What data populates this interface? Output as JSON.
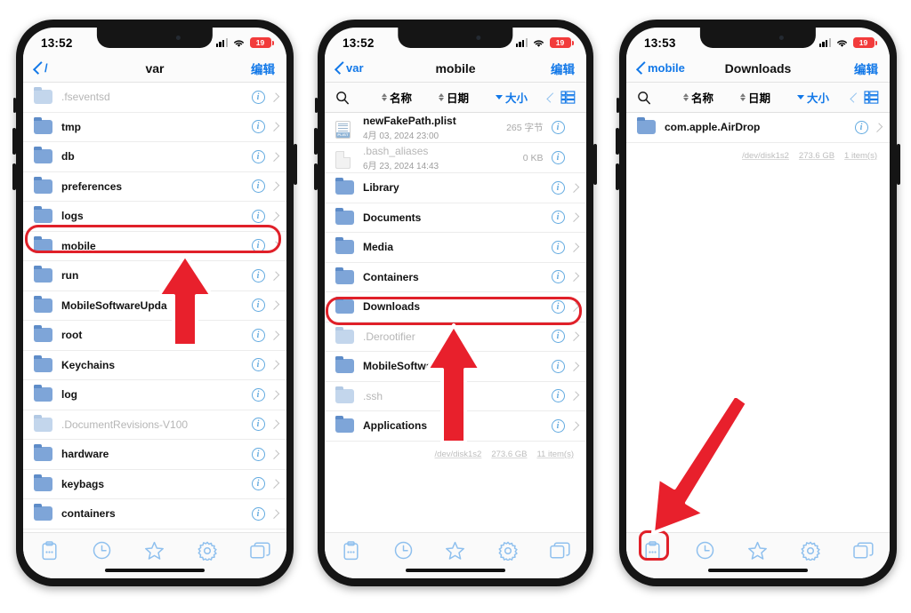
{
  "screenshot": {
    "description": "Three iPhone screenshots of a file manager app showing navigation from /var to mobile to Downloads"
  },
  "phones": [
    {
      "id": "phone-1",
      "status_bar": {
        "time": "13:52",
        "battery": "19",
        "signal_icon": "signal-bars-icon",
        "wifi_icon": "wifi-icon",
        "battery_icon": "battery-low-icon"
      },
      "nav": {
        "back_label": "/",
        "title": "var",
        "edit_label": "编辑"
      },
      "has_sortbar": false,
      "rows": [
        {
          "name": ".fseventsd",
          "kind": "folder",
          "dim": true,
          "clipped": true
        },
        {
          "name": "tmp",
          "kind": "folder",
          "dim": false
        },
        {
          "name": "db",
          "kind": "folder",
          "dim": false
        },
        {
          "name": "preferences",
          "kind": "folder",
          "dim": false
        },
        {
          "name": "logs",
          "kind": "folder",
          "dim": false
        },
        {
          "name": "mobile",
          "kind": "folder",
          "dim": false,
          "highlighted": true
        },
        {
          "name": "run",
          "kind": "folder",
          "dim": false
        },
        {
          "name": "MobileSoftwareUpda",
          "kind": "folder",
          "dim": false
        },
        {
          "name": "root",
          "kind": "folder",
          "dim": false
        },
        {
          "name": "Keychains",
          "kind": "folder",
          "dim": false
        },
        {
          "name": "log",
          "kind": "folder",
          "dim": false
        },
        {
          "name": ".DocumentRevisions-V100",
          "kind": "folder",
          "dim": true
        },
        {
          "name": "hardware",
          "kind": "folder",
          "dim": false
        },
        {
          "name": "keybags",
          "kind": "folder",
          "dim": false
        },
        {
          "name": "containers",
          "kind": "folder",
          "dim": false
        }
      ],
      "meta": null,
      "annotation": {
        "arrow": "up-arrow",
        "highlight": "mobile"
      }
    },
    {
      "id": "phone-2",
      "status_bar": {
        "time": "13:52",
        "battery": "19",
        "signal_icon": "signal-bars-icon",
        "wifi_icon": "wifi-icon",
        "battery_icon": "battery-low-icon"
      },
      "nav": {
        "back_label": "var",
        "title": "mobile",
        "edit_label": "编辑"
      },
      "has_sortbar": true,
      "sortbar": {
        "search_icon": "search-icon",
        "name_label": "名称",
        "date_label": "日期",
        "size_label": "大小",
        "active": "大小",
        "view_icon": "list-view-icon",
        "collapse_icon": "chevron-left-icon"
      },
      "rows": [
        {
          "name": "newFakePath.plist",
          "kind": "plist",
          "sub": "4月 03, 2024 23:00",
          "size": "265 字节",
          "no_chevron": true
        },
        {
          "name": ".bash_aliases",
          "kind": "doc",
          "dim": true,
          "sub": "6月 23, 2024 14:43",
          "size": "0 KB",
          "no_chevron": true
        },
        {
          "name": "Library",
          "kind": "folder",
          "dim": false
        },
        {
          "name": "Documents",
          "kind": "folder",
          "dim": false
        },
        {
          "name": "Media",
          "kind": "folder",
          "dim": false
        },
        {
          "name": "Containers",
          "kind": "folder",
          "dim": false
        },
        {
          "name": "Downloads",
          "kind": "folder",
          "dim": false,
          "highlighted": true
        },
        {
          "name": ".Derootifier",
          "kind": "folder",
          "dim": true
        },
        {
          "name": "MobileSoftwareUpdate",
          "kind": "folder",
          "dim": false
        },
        {
          "name": ".ssh",
          "kind": "folder",
          "dim": true
        },
        {
          "name": "Applications",
          "kind": "folder",
          "dim": false
        }
      ],
      "meta": {
        "device": "/dev/disk1s2",
        "capacity": "273.6 GB",
        "count": "11 item(s)"
      },
      "annotation": {
        "arrow": "up-arrow",
        "highlight": "Downloads"
      }
    },
    {
      "id": "phone-3",
      "status_bar": {
        "time": "13:53",
        "battery": "19",
        "signal_icon": "signal-bars-icon",
        "wifi_icon": "wifi-icon",
        "battery_icon": "battery-low-icon"
      },
      "nav": {
        "back_label": "mobile",
        "title": "Downloads",
        "edit_label": "编辑"
      },
      "has_sortbar": true,
      "sortbar": {
        "search_icon": "search-icon",
        "name_label": "名称",
        "date_label": "日期",
        "size_label": "大小",
        "active": "大小",
        "view_icon": "list-view-icon",
        "collapse_icon": "chevron-left-icon"
      },
      "rows": [
        {
          "name": "com.apple.AirDrop",
          "kind": "folder",
          "dim": false
        }
      ],
      "meta": {
        "device": "/dev/disk1s2",
        "capacity": "273.6 GB",
        "count": "1 item(s)"
      },
      "annotation": {
        "arrow": "down-left-arrow",
        "highlight": "clipboard-tab"
      }
    }
  ],
  "tabbar": {
    "items": [
      {
        "icon": "clipboard-icon",
        "name": "tab-clipboard"
      },
      {
        "icon": "clock-icon",
        "name": "tab-recents"
      },
      {
        "icon": "star-icon",
        "name": "tab-favorites"
      },
      {
        "icon": "gear-icon",
        "name": "tab-settings"
      },
      {
        "icon": "tabs-icon",
        "name": "tab-windows"
      }
    ]
  },
  "colors": {
    "accent": "#1278e8",
    "annotation_red": "#e02029",
    "folder_blue": "#7ea5d8",
    "battery_red": "#f23b3b"
  }
}
